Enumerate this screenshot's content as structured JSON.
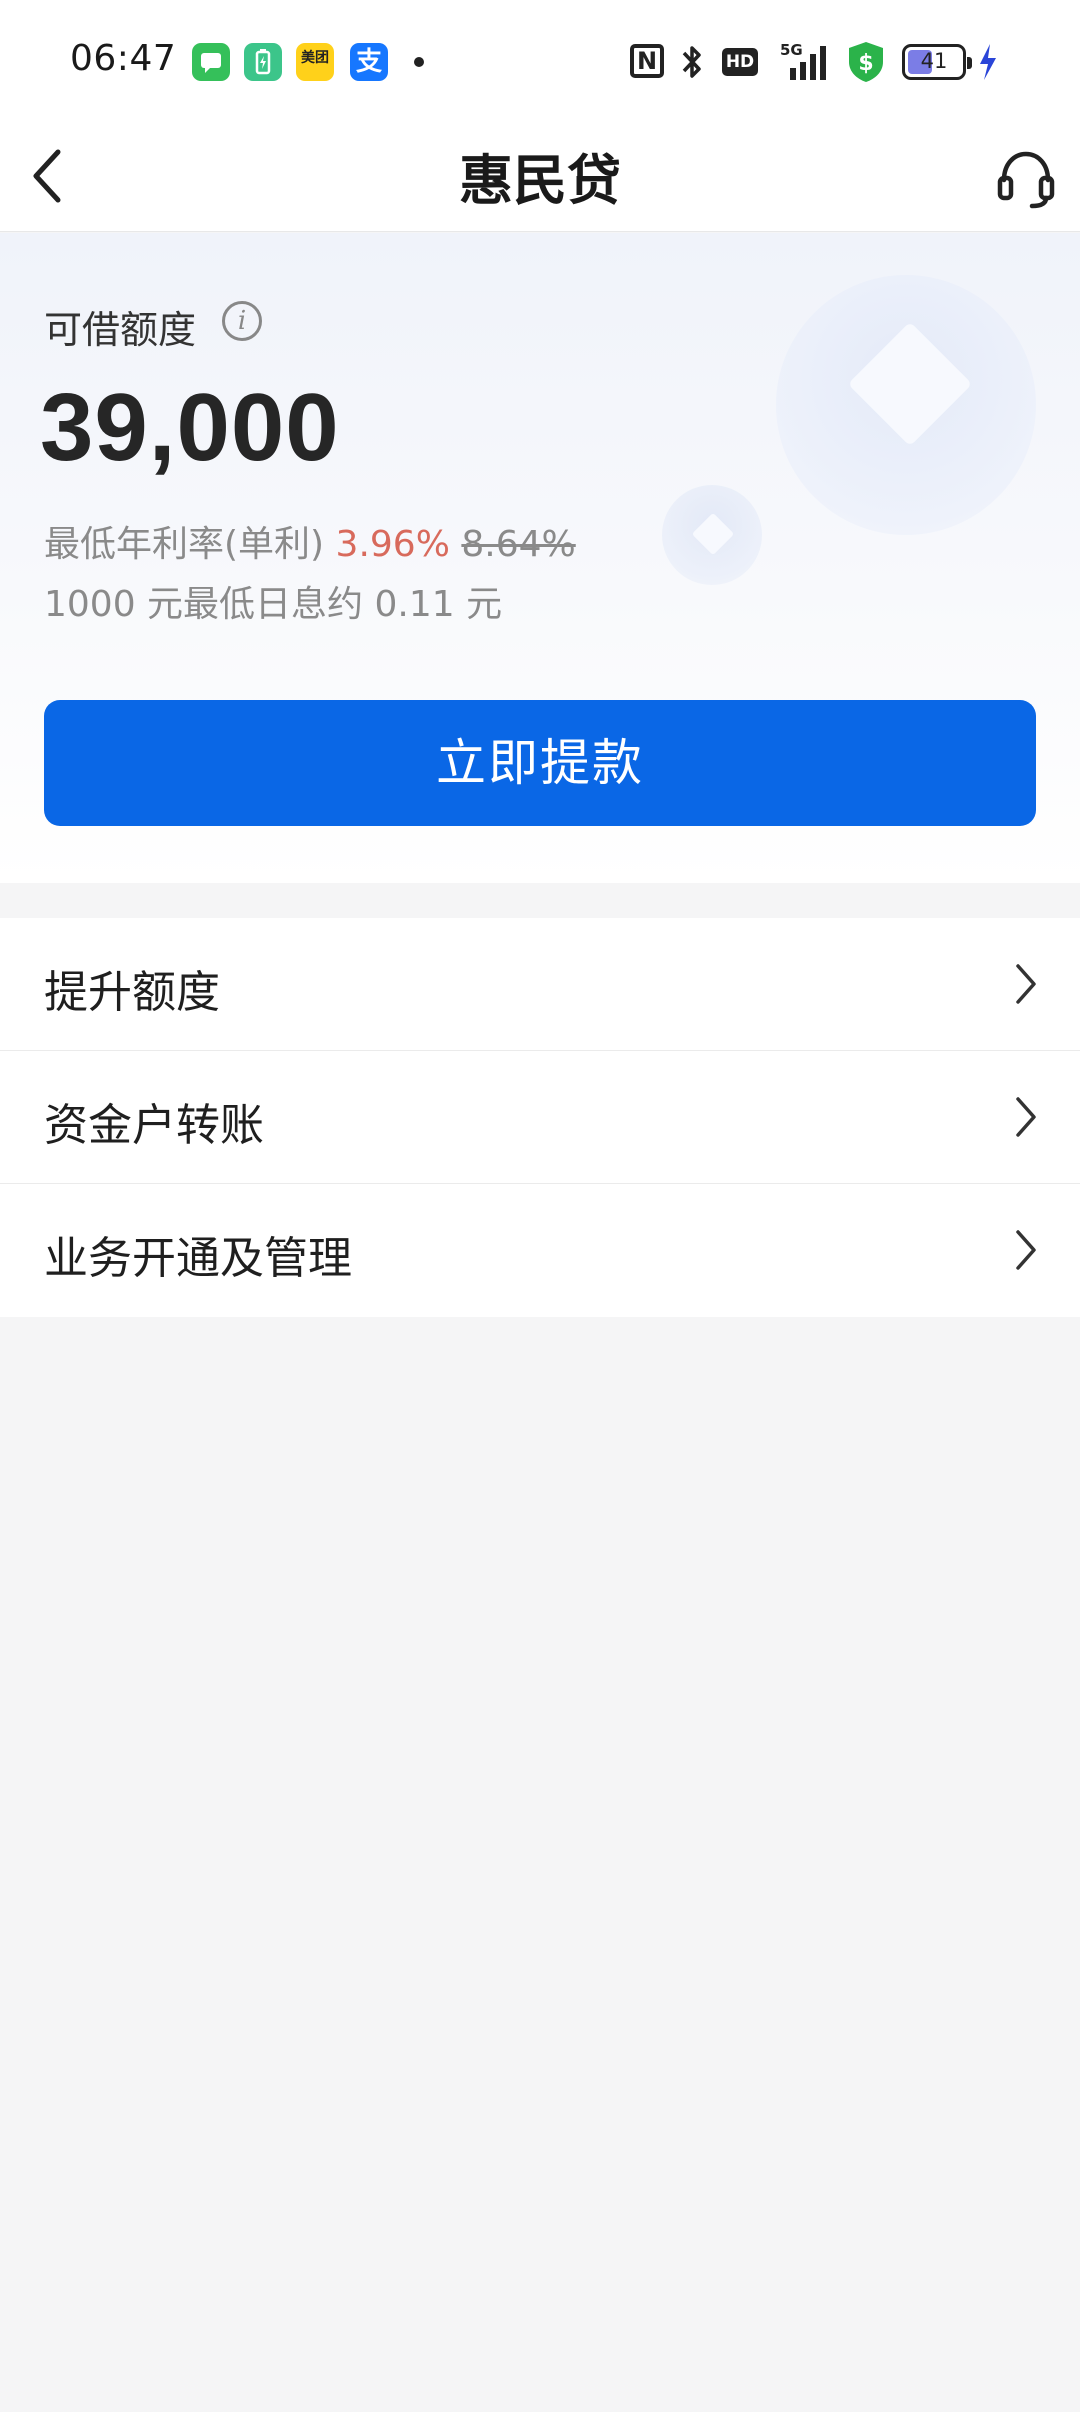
{
  "status_bar": {
    "time": "06:47",
    "app_icons": [
      "messages-icon",
      "battery-manager-icon",
      "meituan-icon",
      "alipay-icon"
    ],
    "meituan_label": "美团",
    "alipay_label": "支",
    "nfc_label": "N",
    "hd_label": "HD",
    "network_label": "5G",
    "battery_level": "41"
  },
  "nav": {
    "title": "惠民贷"
  },
  "hero": {
    "credit_label": "可借额度",
    "credit_amount": "39,000",
    "rate_prefix": "最低年利率(单利) ",
    "rate_now": "3.96%",
    "rate_old": "8.64%",
    "interest_text": "1000 元最低日息约 0.11 元",
    "withdraw_label": "立即提款"
  },
  "menu": {
    "items": [
      {
        "label": "提升额度"
      },
      {
        "label": "资金户转账"
      },
      {
        "label": "业务开通及管理"
      }
    ]
  },
  "colors": {
    "primary_button": "#0a67e6",
    "rate_highlight": "#d86a5c",
    "page_background": "#f5f5f6"
  }
}
